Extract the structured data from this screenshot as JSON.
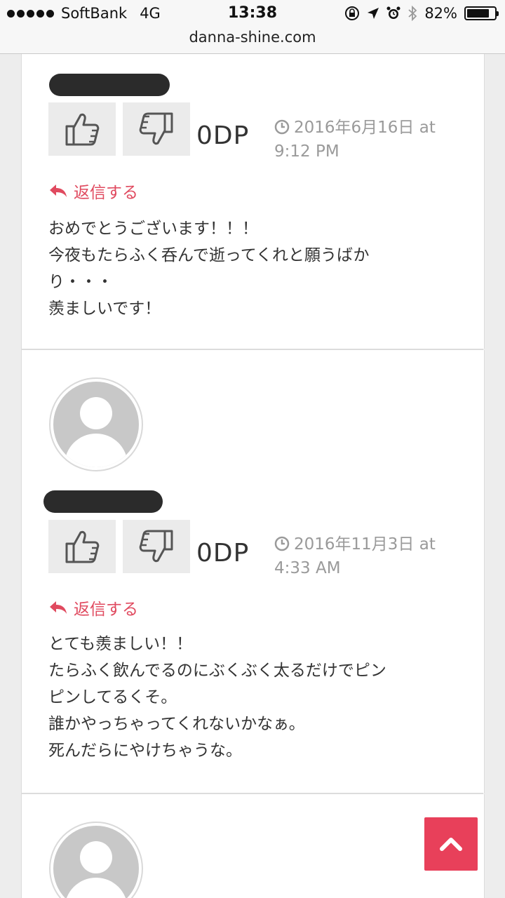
{
  "status_bar": {
    "carrier": "SoftBank",
    "network": "4G",
    "time": "13:38",
    "battery": "82%",
    "battery_level": 0.82
  },
  "url_bar": {
    "domain": "danna-shine.com"
  },
  "comments": [
    {
      "score": "0DP",
      "date_line1": "2016年6月16日 at",
      "date_line2": "9:12 PM",
      "reply_label": "返信する",
      "lines": [
        "おめでとうございます！！！",
        "今夜もたらふく呑んで逝ってくれと願うばか",
        "り・・・",
        "羨ましいです！"
      ]
    },
    {
      "score": "0DP",
      "date_line1": "2016年11月3日 at",
      "date_line2": "4:33 AM",
      "reply_label": "返信する",
      "lines": [
        "とても羨ましい！！",
        "たらふく飲んでるのにぶくぶく太るだけでピン",
        "ピンしてるくそ。",
        "誰かやっちゃってくれないかなぁ。",
        "死んだらにやけちゃうな。"
      ]
    }
  ],
  "colors": {
    "accent": "#e8405a",
    "reply": "#e04a5f",
    "muted": "#9a9a9a"
  },
  "icons": [
    "thumbs-up-icon",
    "thumbs-down-icon",
    "clock-icon",
    "reply-arrow-icon",
    "chevron-up-icon"
  ]
}
